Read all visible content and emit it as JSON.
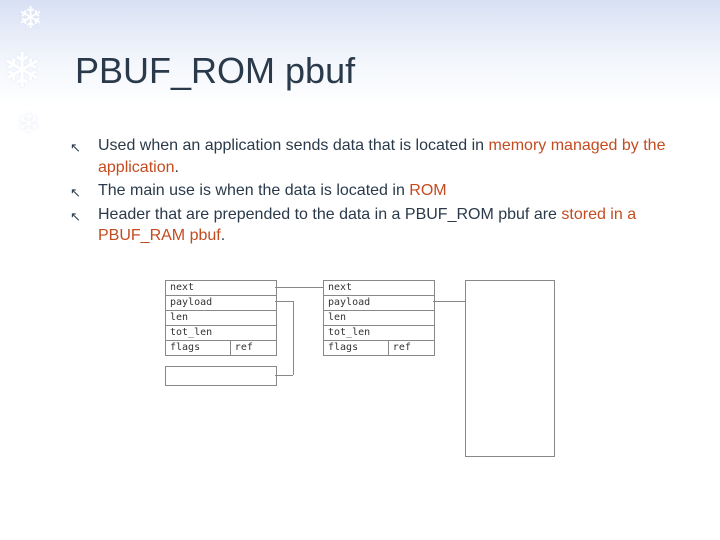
{
  "title": "PBUF_ROM pbuf",
  "bullets": [
    {
      "pre": "Used when an application sends data that is located in ",
      "accent": "memory managed by the application",
      "post": "."
    },
    {
      "pre": "The main use is when the data is located in ",
      "accent": "ROM",
      "post": ""
    },
    {
      "pre": "Header that are prepended to the data in a PBUF_ROM pbuf are ",
      "accent": "stored in a PBUF_RAM pbuf",
      "post": "."
    }
  ],
  "struct_fields": {
    "f0": "next",
    "f1": "payload",
    "f2": "len",
    "f3": "tot_len",
    "f4a": "flags",
    "f4b": "ref"
  }
}
